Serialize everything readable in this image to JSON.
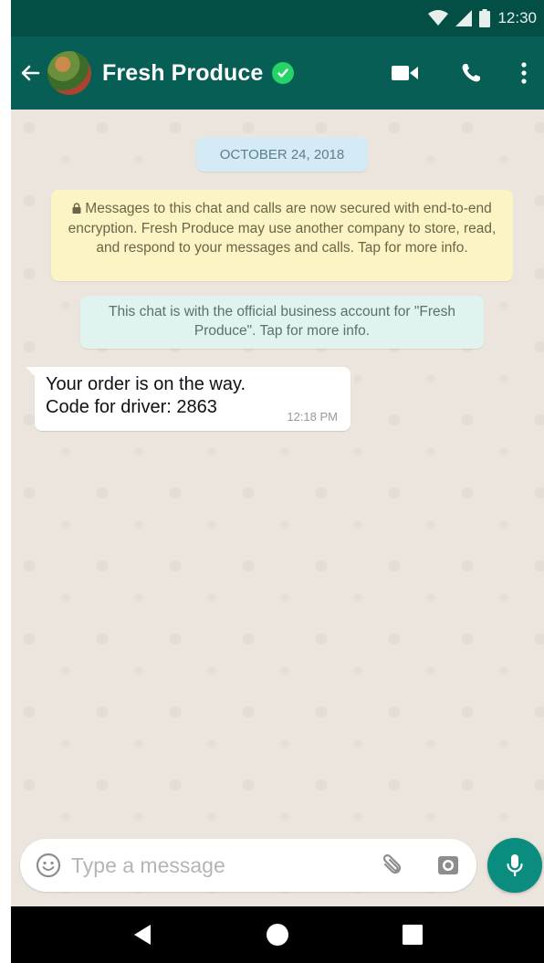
{
  "status_bar": {
    "time": "12:30",
    "icons": [
      "wifi-icon",
      "signal-icon",
      "battery-icon"
    ]
  },
  "app_bar": {
    "contact_name": "Fresh Produce",
    "verified": true,
    "icons": [
      "back-arrow-icon",
      "avatar",
      "verified-check-icon",
      "video-call-icon",
      "voice-call-icon",
      "more-options-icon"
    ]
  },
  "chat": {
    "date_chip": "OCTOBER 24, 2018",
    "encryption_notice": "Messages to this chat and calls are now secured with end-to-end encryption. Fresh Produce may use another company to store, read, and respond to your messages and calls. Tap for more info.",
    "business_notice": "This chat is with the official business account for \"Fresh Produce\". Tap for more info.",
    "messages": [
      {
        "direction": "incoming",
        "lines": [
          "Your order is on the way.",
          "Code for driver: 2863"
        ],
        "time": "12:18 PM"
      }
    ]
  },
  "composer": {
    "placeholder": "Type a message",
    "icons": [
      "emoji-icon",
      "attach-icon",
      "camera-icon",
      "mic-icon"
    ]
  },
  "nav_bar": {
    "icons": [
      "back-triangle-icon",
      "home-circle-icon",
      "recents-square-icon"
    ]
  },
  "colors": {
    "header": "#075e54",
    "status_bar": "#034f46",
    "accent": "#0a8d7e",
    "chat_background": "#ece5dd",
    "date_chip": "#d4eaf4",
    "encryption_notice": "#fcf4c4",
    "business_notice": "#e1f3ee"
  }
}
